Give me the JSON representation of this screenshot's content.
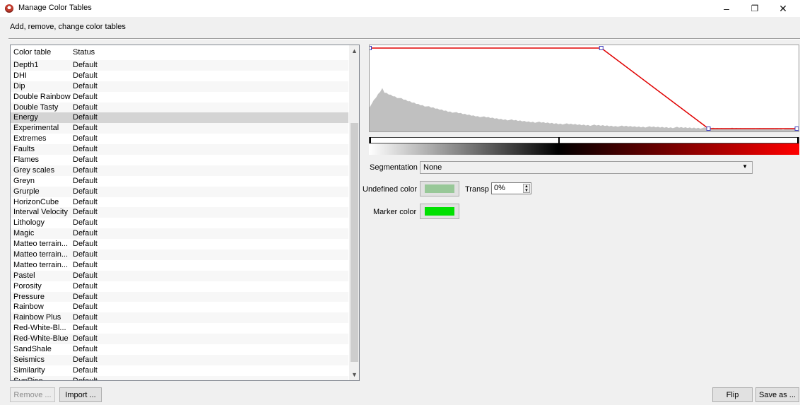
{
  "window": {
    "title": "Manage Color Tables",
    "minimize_glyph": "–",
    "restore_glyph": "❐",
    "close_glyph": "✕"
  },
  "subtitle": "Add, remove, change color tables",
  "list": {
    "headers": {
      "name": "Color table",
      "status": "Status"
    },
    "selected": "Energy",
    "scroll_position": 0.45,
    "rows": [
      {
        "name": "Depth1",
        "status": "Default"
      },
      {
        "name": "DHI",
        "status": "Default"
      },
      {
        "name": "Dip",
        "status": "Default"
      },
      {
        "name": "Double Rainbow",
        "status": "Default"
      },
      {
        "name": "Double Tasty",
        "status": "Default"
      },
      {
        "name": "Energy",
        "status": "Default"
      },
      {
        "name": "Experimental",
        "status": "Default"
      },
      {
        "name": "Extremes",
        "status": "Default"
      },
      {
        "name": "Faults",
        "status": "Default"
      },
      {
        "name": "Flames",
        "status": "Default"
      },
      {
        "name": "Grey scales",
        "status": "Default"
      },
      {
        "name": "Greyn",
        "status": "Default"
      },
      {
        "name": "Grurple",
        "status": "Default"
      },
      {
        "name": "HorizonCube",
        "status": "Default"
      },
      {
        "name": "Interval Velocity",
        "status": "Default"
      },
      {
        "name": "Lithology",
        "status": "Default"
      },
      {
        "name": "Magic",
        "status": "Default"
      },
      {
        "name": "Matteo terrain...",
        "status": "Default"
      },
      {
        "name": "Matteo terrain...",
        "status": "Default"
      },
      {
        "name": "Matteo terrain...",
        "status": "Default"
      },
      {
        "name": "Pastel",
        "status": "Default"
      },
      {
        "name": "Porosity",
        "status": "Default"
      },
      {
        "name": "Pressure",
        "status": "Default"
      },
      {
        "name": "Rainbow",
        "status": "Default"
      },
      {
        "name": "Rainbow Plus",
        "status": "Default"
      },
      {
        "name": "Red-White-Bl...",
        "status": "Default"
      },
      {
        "name": "Red-White-Blue",
        "status": "Default"
      },
      {
        "name": "SandShale",
        "status": "Default"
      },
      {
        "name": "Seismics",
        "status": "Default"
      },
      {
        "name": "Similarity",
        "status": "Default"
      },
      {
        "name": "SunRise",
        "status": "Default"
      }
    ]
  },
  "buttons": {
    "remove": "Remove ...",
    "import": "Import ...",
    "flip": "Flip",
    "save_as": "Save as ..."
  },
  "editor": {
    "segmentation_label": "Segmentation",
    "segmentation_value": "None",
    "undefined_color_label": "Undefined color",
    "undefined_color": "#98c898",
    "transp_label": "Transp",
    "transp_value": "0%",
    "marker_color_label": "Marker color",
    "marker_color": "#00e000",
    "opacity_curve": [
      [
        0,
        1
      ],
      [
        0.54,
        1
      ],
      [
        0.79,
        0
      ],
      [
        1,
        0
      ]
    ],
    "color_stops": [
      {
        "pos": 0.0,
        "color": "#ffffff"
      },
      {
        "pos": 0.44,
        "color": "#000000"
      },
      {
        "pos": 1.0,
        "color": "#ff0000"
      }
    ],
    "range_ticks": [
      0.0,
      0.44,
      1.0
    ],
    "curve_color": "#e00000",
    "histogram_color": "#c0c0c0"
  }
}
